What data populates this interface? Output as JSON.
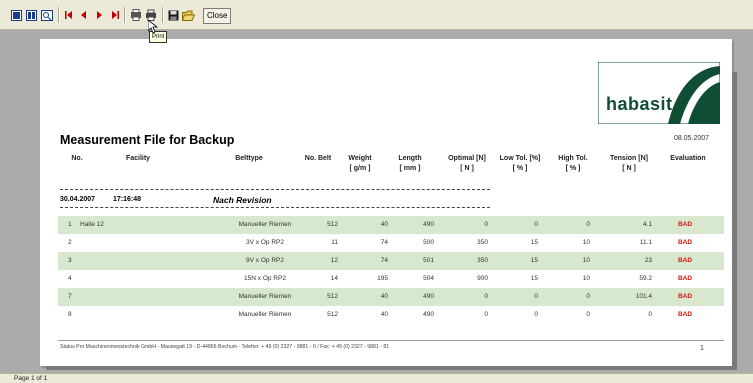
{
  "toolbar": {
    "buttons": [
      "single-page",
      "two-pages",
      "zoom",
      "first",
      "previous",
      "next",
      "last",
      "export",
      "print",
      "save",
      "open"
    ],
    "close_label": "Close",
    "tooltip": "Print"
  },
  "report": {
    "logo_text": "habasit",
    "title": "Measurement File for Backup",
    "print_date": "08.05.2007",
    "headers": {
      "no": "No.",
      "facility": "Facility",
      "belttype": "Belttype",
      "no_belt": "No. Belt",
      "weight_1": "Weight",
      "weight_2": "[ g/m ]",
      "length_1": "Length",
      "length_2": "[ mm ]",
      "optimal_1": "Optimal [N]",
      "optimal_2": "[ N ]",
      "low_tol_1": "Low Tol. [%]",
      "low_tol_2": "[ % ]",
      "high_tol_1": "High Tol.",
      "high_tol_2": "[ % ]",
      "tension_1": "Tension [N]",
      "tension_2": "[ N ]",
      "evaluation": "Evaluation"
    },
    "group": {
      "date": "30.04.2007",
      "time": "17:16:48",
      "revision": "Nach Revision"
    },
    "rows": [
      {
        "no": "1",
        "facility": "Halle 12",
        "belttype": "Manueller Riemen",
        "no_belt": "512",
        "weight": "40",
        "length": "490",
        "optimal": "0",
        "low_tol": "0",
        "high_tol": "0",
        "tension": "4.1",
        "evaluation": "BAD"
      },
      {
        "no": "2",
        "facility": "",
        "belttype": "3V x Op RP2",
        "no_belt": "11",
        "weight": "74",
        "length": "500",
        "optimal": "350",
        "low_tol": "15",
        "high_tol": "10",
        "tension": "11.1",
        "evaluation": "BAD"
      },
      {
        "no": "3",
        "facility": "",
        "belttype": "9V x Op RP2",
        "no_belt": "12",
        "weight": "74",
        "length": "501",
        "optimal": "350",
        "low_tol": "15",
        "high_tol": "10",
        "tension": "23",
        "evaluation": "BAD"
      },
      {
        "no": "4",
        "facility": "",
        "belttype": "15N x Op RP2",
        "no_belt": "14",
        "weight": "195",
        "length": "504",
        "optimal": "900",
        "low_tol": "15",
        "high_tol": "10",
        "tension": "59.2",
        "evaluation": "BAD"
      },
      {
        "no": "7",
        "facility": "",
        "belttype": "Manueller Riemen",
        "no_belt": "512",
        "weight": "40",
        "length": "490",
        "optimal": "0",
        "low_tol": "0",
        "high_tol": "0",
        "tension": "101.4",
        "evaluation": "BAD"
      },
      {
        "no": "8",
        "facility": "",
        "belttype": "Manueller Riemen",
        "no_belt": "512",
        "weight": "40",
        "length": "490",
        "optimal": "0",
        "low_tol": "0",
        "high_tol": "0",
        "tension": "0",
        "evaluation": "BAD"
      }
    ],
    "footer": "Status Pro Maschinenmesstechnik GmbH - Mausegatt 19 - D-44866 Bochum - Telefon: + 49 (0) 2327 - 9881 - 0 / Fax: + 49 (0) 2327 - 9881 - 81",
    "page_number": "1"
  },
  "status_bar": {
    "text": "Page 1 of 1"
  },
  "colors": {
    "row_alt": "#d7e8cf",
    "bad": "#e01010",
    "logo_green": "#0f4d35"
  }
}
